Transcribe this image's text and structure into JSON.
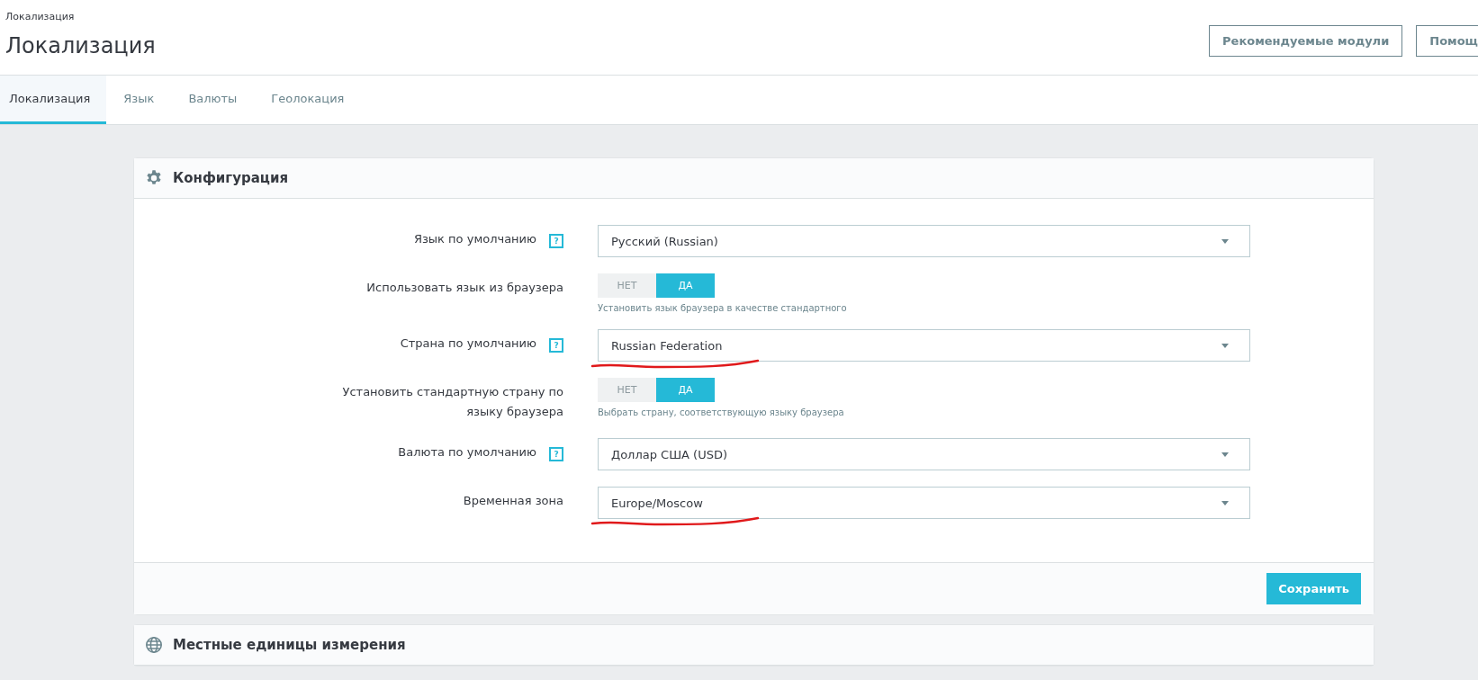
{
  "breadcrumb": "Локализация",
  "page_title": "Локализация",
  "toolbar_buttons": [
    {
      "label": "Рекомендуемые модули"
    },
    {
      "label": "Помощ"
    }
  ],
  "tabs": [
    {
      "label": "Локализация",
      "selected": true
    },
    {
      "label": "Язык",
      "selected": false
    },
    {
      "label": "Валюты",
      "selected": false
    },
    {
      "label": "Геолокация",
      "selected": false
    }
  ],
  "panels": [
    {
      "title": "Конфигурация",
      "fields": [
        {
          "kind": "select",
          "label": "Язык по умолчанию",
          "help": "?",
          "value": "Русский (Russian)",
          "underlined": false
        },
        {
          "kind": "switch",
          "label": "Использовать язык из браузера",
          "off_label": "НЕТ",
          "on_label": "ДА",
          "on": true,
          "hint": "Установить язык браузера в качестве стандартного"
        },
        {
          "kind": "select",
          "label": "Страна по умолчанию",
          "help": "?",
          "value": "Russian Federation",
          "underlined": true
        },
        {
          "kind": "switch",
          "label": "Установить стандартную страну по языку браузера",
          "off_label": "НЕТ",
          "on_label": "ДА",
          "on": true,
          "hint": "Выбрать страну, соответствующую языку браузера"
        },
        {
          "kind": "select",
          "label": "Валюта по умолчанию",
          "help": "?",
          "value": "Доллар США (USD)",
          "underlined": false
        },
        {
          "kind": "select",
          "label": "Временная зона",
          "value": "Europe/Moscow",
          "underlined": true
        }
      ],
      "save_button": "Сохранить"
    },
    {
      "title": "Местные единицы измерения"
    }
  ]
}
